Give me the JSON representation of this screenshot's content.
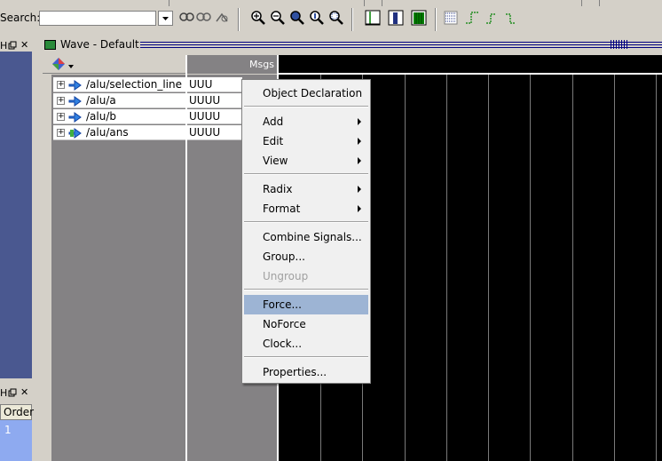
{
  "toolbar": {
    "search_label": "Search:",
    "search_value": "",
    "search_placeholder": ""
  },
  "left_dock": {
    "order_label": "Order",
    "row_number": "1"
  },
  "wave_window": {
    "title": "Wave - Default",
    "msgs_header": "Msgs",
    "signals": [
      {
        "name": "/alu/selection_line",
        "value": "UUU"
      },
      {
        "name": "/alu/a",
        "value": "UUUU"
      },
      {
        "name": "/alu/b",
        "value": "UUUU"
      },
      {
        "name": "/alu/ans",
        "value": "UUUU"
      }
    ]
  },
  "context_menu": {
    "items": [
      {
        "label": "Object Declaration"
      },
      {
        "label": "Add"
      },
      {
        "label": "Edit"
      },
      {
        "label": "View"
      },
      {
        "label": "Radix"
      },
      {
        "label": "Format"
      },
      {
        "label": "Combine Signals..."
      },
      {
        "label": "Group..."
      },
      {
        "label": "Ungroup"
      },
      {
        "label": "Force..."
      },
      {
        "label": "NoForce"
      },
      {
        "label": "Clock..."
      },
      {
        "label": "Properties..."
      }
    ]
  },
  "colors": {
    "wave_background": "#000000",
    "menu_highlight": "#9db4d4",
    "left_panel": "#4a5890"
  }
}
